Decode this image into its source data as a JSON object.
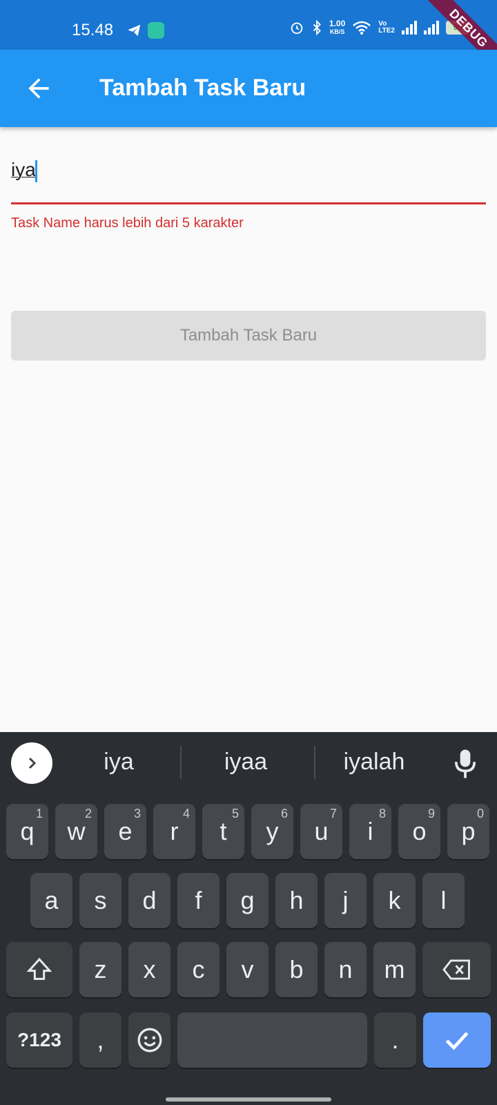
{
  "status_bar": {
    "time": "15.48",
    "net_speed_value": "1.00",
    "net_speed_unit": "KB/S",
    "volte_top": "Vo",
    "volte_bottom": "LTE2",
    "battery": "98"
  },
  "debug_ribbon": "DEBUG",
  "app_bar": {
    "title": "Tambah Task Baru",
    "back_icon": "arrow-left-icon"
  },
  "form": {
    "task_name_value": "iya",
    "error_message": "Task Name harus lebih dari 5 karakter",
    "submit_label": "Tambah Task Baru"
  },
  "keyboard": {
    "suggestions": [
      "iya",
      "iyaa",
      "iyalah"
    ],
    "row1": [
      {
        "k": "q",
        "h": "1"
      },
      {
        "k": "w",
        "h": "2"
      },
      {
        "k": "e",
        "h": "3"
      },
      {
        "k": "r",
        "h": "4"
      },
      {
        "k": "t",
        "h": "5"
      },
      {
        "k": "y",
        "h": "6"
      },
      {
        "k": "u",
        "h": "7"
      },
      {
        "k": "i",
        "h": "8"
      },
      {
        "k": "o",
        "h": "9"
      },
      {
        "k": "p",
        "h": "0"
      }
    ],
    "row2": [
      "a",
      "s",
      "d",
      "f",
      "g",
      "h",
      "j",
      "k",
      "l"
    ],
    "row3": [
      "z",
      "x",
      "c",
      "v",
      "b",
      "n",
      "m"
    ],
    "symbols_label": "?123",
    "comma_label": ",",
    "period_label": "."
  },
  "colors": {
    "status_bar": "#1976d2",
    "app_bar": "#2196f3",
    "error": "#d32f2f",
    "keyboard_bg": "#2b2f33",
    "enter_key": "#5e97f6"
  }
}
